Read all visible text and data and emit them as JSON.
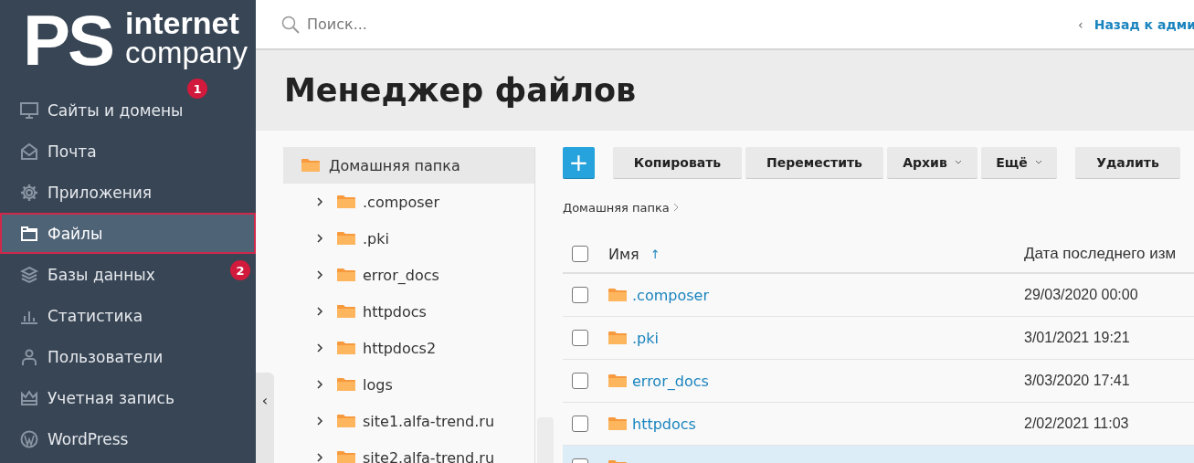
{
  "logo": {
    "mark": "PS",
    "line_1": "internet",
    "line_2": "company"
  },
  "sidebar": {
    "items": [
      {
        "label": "Сайты и домены",
        "kind": "monitor",
        "selected": false,
        "highlighted": false
      },
      {
        "label": "Почта",
        "kind": "mail",
        "selected": false,
        "highlighted": false
      },
      {
        "label": "Приложения",
        "kind": "gear",
        "selected": false,
        "highlighted": false
      },
      {
        "label": "Файлы",
        "kind": "folder",
        "selected": true,
        "highlighted": true
      },
      {
        "label": "Базы данных",
        "kind": "layers",
        "selected": false,
        "highlighted": false
      },
      {
        "label": "Статистика",
        "kind": "chart",
        "selected": false,
        "highlighted": false
      },
      {
        "label": "Пользователи",
        "kind": "user",
        "selected": false,
        "highlighted": false
      },
      {
        "label": "Учетная запись",
        "kind": "crown",
        "selected": false,
        "highlighted": false
      },
      {
        "label": "WordPress",
        "kind": "wordpress",
        "selected": false,
        "highlighted": false
      }
    ]
  },
  "annotations": [
    {
      "label": "1"
    },
    {
      "label": "2"
    }
  ],
  "search": {
    "placeholder": "Поиск..."
  },
  "back_link": {
    "chevron": "‹",
    "label": "Назад к адми"
  },
  "page_title": "Менеджер файлов",
  "collapse_handle": {
    "label": "‹"
  },
  "tree": {
    "root": {
      "label": "Домашняя папка",
      "selected": true,
      "children": [
        {
          "label": ".composer",
          "expanded": false
        },
        {
          "label": ".pki",
          "expanded": false
        },
        {
          "label": "error_docs",
          "expanded": false
        },
        {
          "label": "httpdocs",
          "expanded": false
        },
        {
          "label": "httpdocs2",
          "expanded": false
        },
        {
          "label": "logs",
          "expanded": false
        },
        {
          "label": "site1.alfa-trend.ru",
          "expanded": false
        },
        {
          "label": "site2.alfa-trend.ru",
          "expanded": false
        }
      ]
    }
  },
  "toolbar": {
    "buttons": [
      {
        "kind": "add",
        "label": "+"
      },
      {
        "kind": "plain",
        "label": "Копировать"
      },
      {
        "kind": "plain",
        "label": "Переместить"
      },
      {
        "kind": "menu",
        "label": "Архив"
      },
      {
        "kind": "menu",
        "label": "Ещё"
      },
      {
        "kind": "plain",
        "label": "Удалить"
      }
    ]
  },
  "breadcrumb": [
    "Домашняя папка"
  ],
  "table": {
    "columns": [
      {
        "label": "Имя",
        "sort_mark": "↑"
      },
      {
        "label": "Дата последнего изм"
      }
    ],
    "all_checked": false,
    "rows": [
      {
        "name": ".composer",
        "modified": "29/03/2020 00:00",
        "checked": false,
        "hovered": false
      },
      {
        "name": ".pki",
        "modified": "3/01/2021 19:21",
        "checked": false,
        "hovered": false
      },
      {
        "name": "error_docs",
        "modified": "3/03/2020 17:41",
        "checked": false,
        "hovered": false
      },
      {
        "name": "httpdocs",
        "modified": "2/02/2021 11:03",
        "checked": false,
        "hovered": false
      },
      {
        "checked": false,
        "hovered": true
      }
    ]
  }
}
